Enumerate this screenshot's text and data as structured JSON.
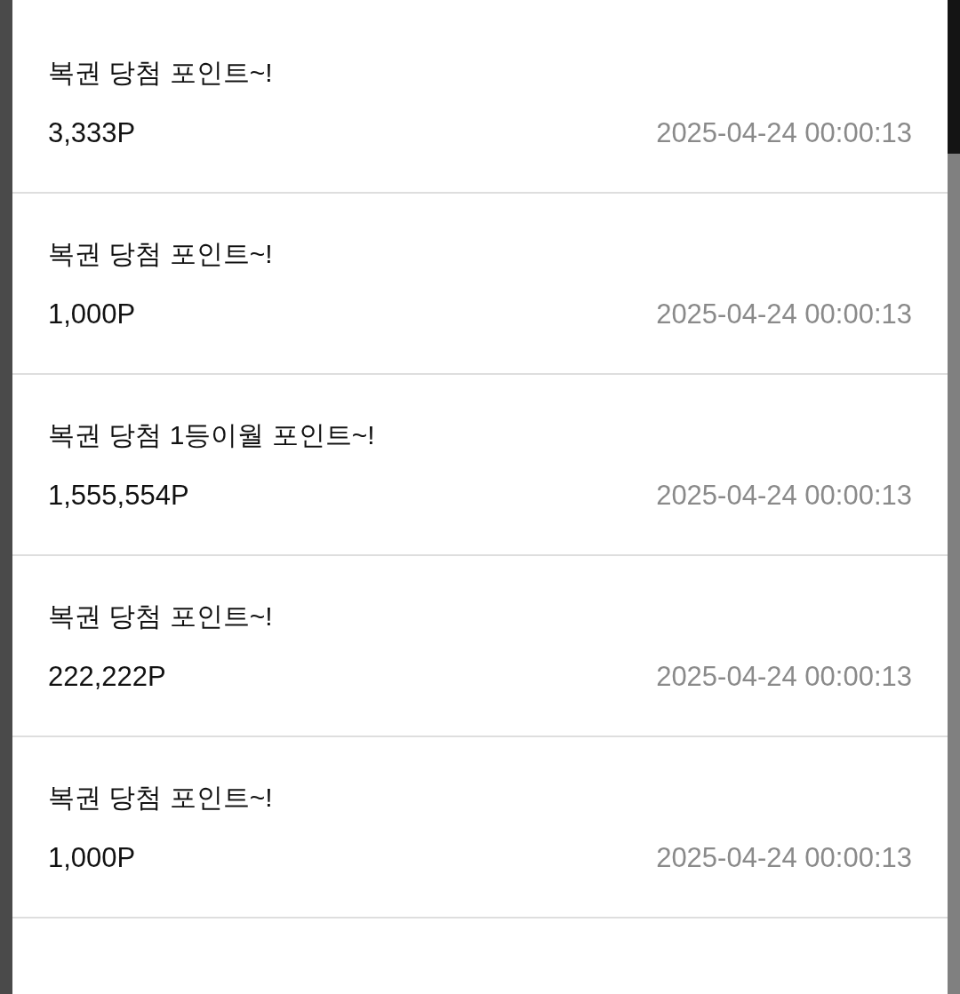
{
  "points": [
    {
      "title": "복권 당첨 포인트~!",
      "amount": "3,333P",
      "date": "2025-04-24 00:00:13"
    },
    {
      "title": "복권 당첨 포인트~!",
      "amount": "1,000P",
      "date": "2025-04-24 00:00:13"
    },
    {
      "title": "복권 당첨 1등이월 포인트~!",
      "amount": "1,555,554P",
      "date": "2025-04-24 00:00:13"
    },
    {
      "title": "복권 당첨 포인트~!",
      "amount": "222,222P",
      "date": "2025-04-24 00:00:13"
    },
    {
      "title": "복권 당첨 포인트~!",
      "amount": "1,000P",
      "date": "2025-04-24 00:00:13"
    }
  ]
}
